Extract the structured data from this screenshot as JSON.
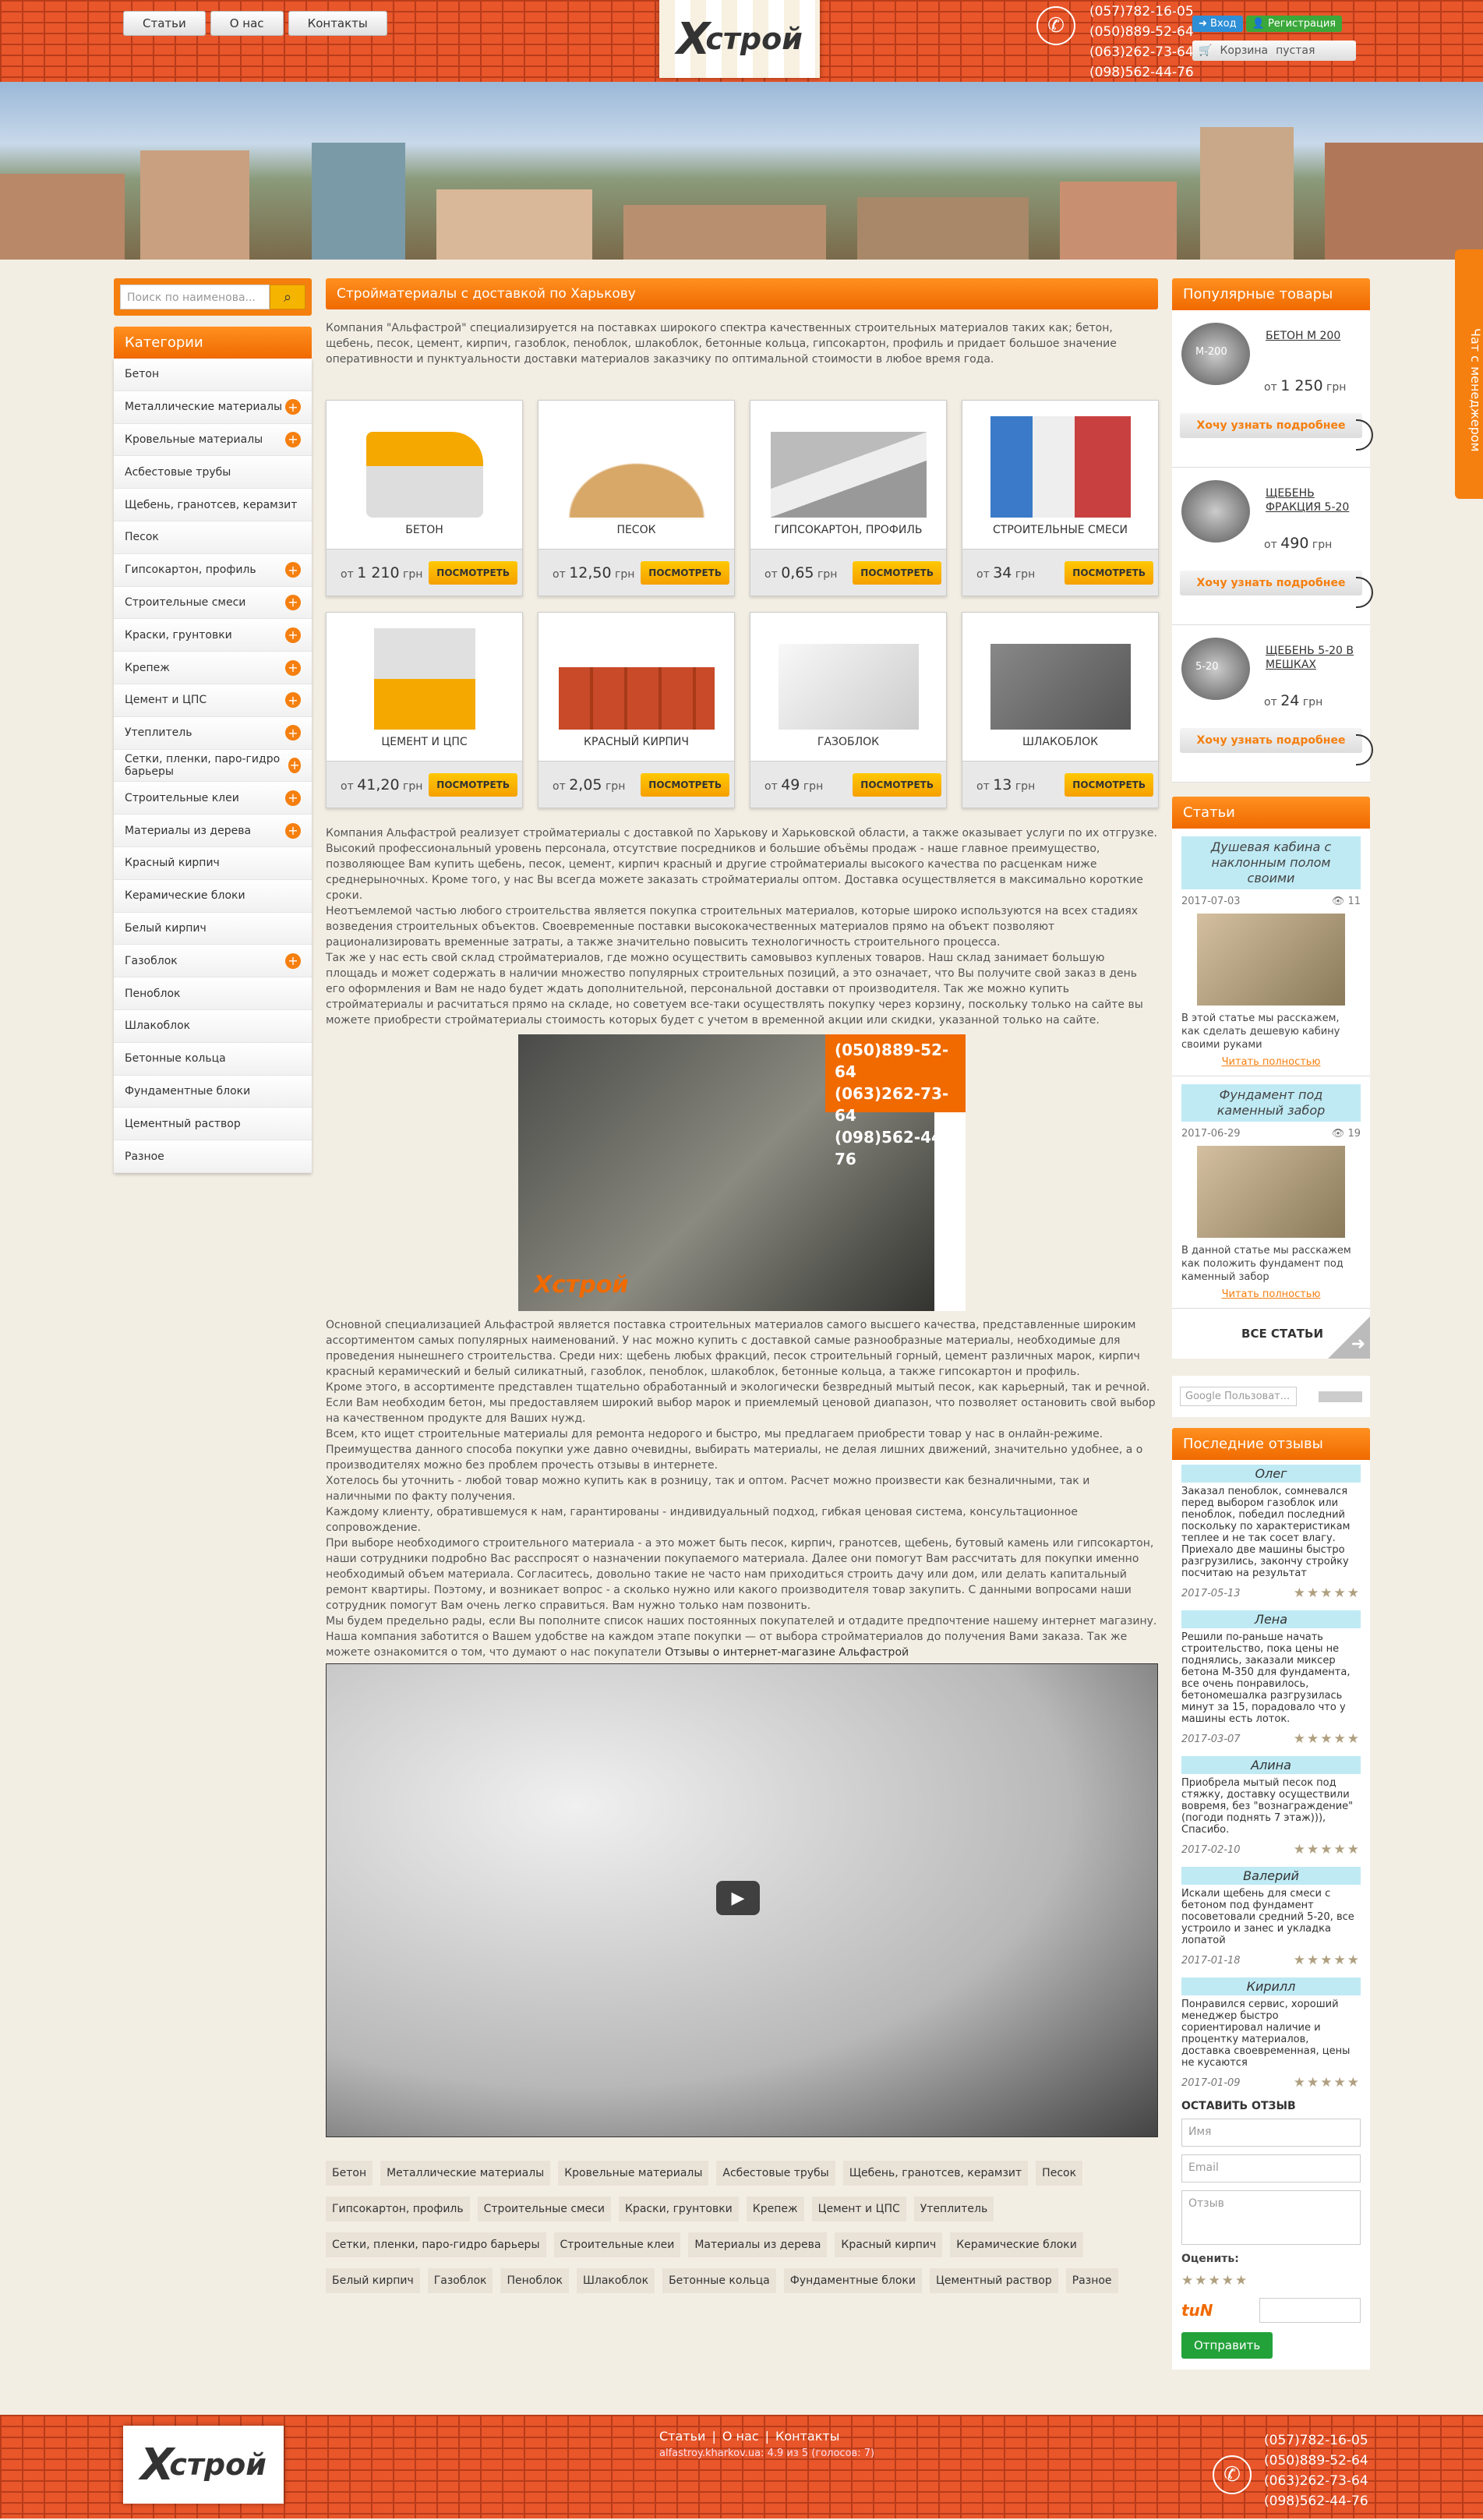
{
  "header": {
    "nav": [
      "Статьи",
      "О нас",
      "Контакты"
    ],
    "logo_text": "строй",
    "phones": [
      "(057)782-16-05",
      "(050)889-52-64",
      "(063)262-73-64",
      "(098)562-44-76"
    ],
    "login": "Вход",
    "register": "Регистрация",
    "cart_label": "Корзина",
    "cart_status": "пустая"
  },
  "search": {
    "placeholder": "Поиск по наименова..."
  },
  "categories": {
    "title": "Категории",
    "items": [
      {
        "label": "Бетон",
        "plus": false
      },
      {
        "label": "Металлические материалы",
        "plus": true
      },
      {
        "label": "Кровельные материалы",
        "plus": true
      },
      {
        "label": "Асбестовые трубы",
        "plus": false
      },
      {
        "label": "Щебень, гранотсев, керамзит",
        "plus": false
      },
      {
        "label": "Песок",
        "plus": false
      },
      {
        "label": "Гипсокартон, профиль",
        "plus": true
      },
      {
        "label": "Строительные смеси",
        "plus": true
      },
      {
        "label": "Краски, грунтовки",
        "plus": true
      },
      {
        "label": "Крепеж",
        "plus": true
      },
      {
        "label": "Цемент и ЦПС",
        "plus": true
      },
      {
        "label": "Утеплитель",
        "plus": true
      },
      {
        "label": "Сетки, пленки, паро-гидро барьеры",
        "plus": true
      },
      {
        "label": "Строительные клеи",
        "plus": true
      },
      {
        "label": "Материалы из дерева",
        "plus": true
      },
      {
        "label": "Красный кирпич",
        "plus": false
      },
      {
        "label": "Керамические блоки",
        "plus": false
      },
      {
        "label": "Белый кирпич",
        "plus": false
      },
      {
        "label": "Газоблок",
        "plus": true
      },
      {
        "label": "Пеноблок",
        "plus": false
      },
      {
        "label": "Шлакоблок",
        "plus": false
      },
      {
        "label": "Бетонные кольца",
        "plus": false
      },
      {
        "label": "Фундаментные блоки",
        "plus": false
      },
      {
        "label": "Цементный раствор",
        "plus": false
      },
      {
        "label": "Разное",
        "plus": false
      }
    ]
  },
  "main": {
    "title": "Стройматериалы с доставкой по Харькову",
    "intro": "Компания \"Альфастрой\" специализируется на поставках широкого спектра качественных строительных материалов таких как; бетон, щебень, песок, цемент, кирпич, газоблок, пеноблок, шлакоблок, бетонные кольца, гипсокартон, профиль и придает большое значение оперативности и пунктуальности доставки материалов заказчику по оптимальной стоимости в любое время года.",
    "price_prefix": "от",
    "currency": "грн",
    "look_label": "ПОСМОТРЕТЬ",
    "products": [
      {
        "name": "БЕТОН",
        "price": "1 210"
      },
      {
        "name": "ПЕСОК",
        "price": "12,50"
      },
      {
        "name": "ГИПСОКАРТОН, ПРОФИЛЬ",
        "price": "0,65"
      },
      {
        "name": "СТРОИТЕЛЬНЫЕ СМЕСИ",
        "price": "34"
      },
      {
        "name": "ЦЕМЕНТ И ЦПС",
        "price": "41,20"
      },
      {
        "name": "КРАСНЫЙ КИРПИЧ",
        "price": "2,05"
      },
      {
        "name": "ГАЗОБЛОК",
        "price": "49"
      },
      {
        "name": "ШЛАКОБЛОК",
        "price": "13"
      }
    ],
    "body1": "Компания Альфастрой реализует стройматериалы с доставкой по Харькову и Харьковской области, а также оказывает услуги по их отгрузке. Высокий профессиональный уровень персонала, отсутствие посредников и большие объёмы продаж - наше главное преимущество, позволяющее Вам купить щебень, песок, цемент, кирпич красный и другие стройматериалы высокого качества по расценкам ниже среднерыночных. Кроме того, у нас Вы всегда можете заказать стройматериалы оптом. Доставка осуществляется в максимально короткие сроки.",
    "body2": "Неотъемлемой частью любого строительства является покупка строительных материалов, которые широко используются на всех стадиях возведения строительных объектов. Своевременные поставки высококачественных материалов прямо на объект позволяют рационализировать временные затраты, а также значительно повысить технологичность строительного процесса.",
    "body3": "Так же у нас есть свой склад стройматериалов, где можно осуществить самовывоз купленых товаров. Наш склад занимает большую площадь и может содержать в наличии множество популярных строительных позиций, а это означает, что Вы получите свой заказ в день его оформления и Вам не надо будет ждать дополнительной, персональной доставки от производителя. Так же можно купить стройматериалы и расчитаться прямо на складе, но советуем все-таки осуществлять покупку через корзину, поскольку только на сайте вы можете приобрести стройматериалы стоимость которых будет с учетом в временной акции или скидки, указанной только на сайте.",
    "warehouse_phones": [
      "(050)889-52-64",
      "(063)262-73-64",
      "(098)562-44-76"
    ],
    "body4": "Основной специализацией Альфастрой является поставка строительных материалов самого высшего качества, представленные широким ассортиментом самых популярных наименований. У нас можно купить с доставкой самые разнообразные материалы, необходимые для проведения нынешнего строительства. Среди них: щебень любых фракций, песок строительный горный, цемент различных марок, кирпич красный керамический и белый силикатный, газоблок, пеноблок, шлакоблок, бетонные кольца, а также гипсокартон и профиль.",
    "body5": "Кроме этого, в ассортименте представлен тщательно обработанный и экологически безвредный мытый песок, как карьерный, так и речной. Если Вам необходим бетон, мы предоставляем широкий выбор марок и приемлемый ценовой диапазон, что позволяет остановить свой выбор на качественном продукте для Ваших нужд.",
    "body6": "Всем, кто ищет строительные материалы для ремонта недорого и быстро, мы предлагаем приобрести товар у нас в онлайн-режиме. Преимущества данного способа покупки уже давно очевидны, выбирать материалы, не делая лишних движений, значительно удобнее, а о производителях можно без проблем прочесть отзывы в интернете.",
    "body7": "Хотелось бы уточнить - любой товар можно купить как в розницу, так и оптом. Расчет можно произвести как безналичными, так и наличными по факту получения.",
    "body8": "Каждому клиенту, обратившемуся к нам, гарантированы - индивидуальный подход, гибкая ценовая система, консультационное сопровождение.",
    "body9": "При выборе необходимого строительного материала - а это может быть песок, кирпич, гранотсев, щебень, бутовый камень или гипсокартон, наши сотрудники подробно Вас расспросят о назначении покупаемого материала. Далее они помогут Вам рассчитать для покупки именно необходимый объем материала. Согласитесь, довольно такие не часто нам приходиться строить дачу или дом, или делать капитальный ремонт квартиры. Поэтому, и возникает вопрос - а сколько нужно или какого производителя товар закупить. С данными вопросами наши сотрудник помогут Вам очень легко справиться. Вам нужно только нам позвонить.",
    "body10": "Мы будем предельно рады, если Вы пополните список наших постоянных покупателей и отдадите предпочтение нашему интернет магазину. Наша компания заботится о Вашем удобстве на каждом этапе покупки — от выбора стройматериалов до получения Вами заказа. Так же можете ознакомится о том, что думают о нас покупатели",
    "reviews_link": "Отзывы о интернет-магазине Альфастрой",
    "tags": [
      "Бетон",
      "Металлические материалы",
      "Кровельные материалы",
      "Асбестовые трубы",
      "Щебень, гранотсев, керамзит",
      "Песок",
      "Гипсокартон, профиль",
      "Строительные смеси",
      "Краски, грунтовки",
      "Крепеж",
      "Цемент и ЦПС",
      "Утеплитель",
      "Сетки, пленки, паро-гидро барьеры",
      "Строительные клеи",
      "Материалы из дерева",
      "Красный кирпич",
      "Керамические блоки",
      "Белый кирпич",
      "Газоблок",
      "Пеноблок",
      "Шлакоблок",
      "Бетонные кольца",
      "Фундаментные блоки",
      "Цементный раствор",
      "Разное"
    ]
  },
  "popular": {
    "title": "Популярные товары",
    "want_label": "Хочу узнать подробнее",
    "items": [
      {
        "name": "БЕТОН М 200",
        "price": "1 250",
        "img_label": "М-200"
      },
      {
        "name": "ЩЕБЕНЬ ФРАКЦИЯ 5-20",
        "price": "490",
        "img_label": ""
      },
      {
        "name": "ЩЕБЕНЬ 5-20 В МЕШКАХ",
        "price": "24",
        "img_label": "5-20"
      }
    ]
  },
  "articles": {
    "title": "Статьи",
    "read_more": "Читать полностью",
    "all_label": "ВСЕ СТАТЬИ",
    "items": [
      {
        "title": "Душевая кабина с наклонным полом своими",
        "date": "2017-07-03",
        "views": "11",
        "text": "В этой статье мы расскажем, как сделать дешевую кабину своими руками"
      },
      {
        "title": "Фундамент под каменный забор",
        "date": "2017-06-29",
        "views": "19",
        "text": "В данной статье мы расскажем как положить фундамент под каменный забор"
      }
    ]
  },
  "google_search": {
    "placeholder": "Google Пользоват..."
  },
  "reviews": {
    "title": "Последние отзывы",
    "stars": "★★★★★",
    "items": [
      {
        "name": "Олег",
        "text": "Заказал пеноблок, сомневался перед выбором газоблок или пеноблок, победил последний поскольку по характеристикам теплее и не так сосет влагу. Приехало две машины быстро разгрузились, закончу стройку посчитаю на результат",
        "date": "2017-05-13"
      },
      {
        "name": "Лена",
        "text": "Решили по-раньше начать строительство, пока цены не поднялись, заказали миксер бетона М-350 для фундамента, все очень понравилось, бетономешалка разгрузилась минут за 15, порадовало что у машины есть лоток.",
        "date": "2017-03-07"
      },
      {
        "name": "Алина",
        "text": "Приобрела мытый песок под стяжку, доставку осуществили вовремя, без \"вознаграждение\" (погоди поднять 7 этаж))), Спасибо.",
        "date": "2017-02-10"
      },
      {
        "name": "Валерий",
        "text": "Искали щебень для смеси с бетоном под фундамент посоветовали средний 5-20, все устроило и занес и укладка лопатой",
        "date": "2017-01-18"
      },
      {
        "name": "Кирилл",
        "text": "Понравился сервис, хороший менеджер быстро сориентировал наличие и процентку материалов, доставка своевременная, цены не кусаются",
        "date": "2017-01-09"
      }
    ],
    "form_title": "ОСТАВИТЬ ОТЗЫВ",
    "name_ph": "Имя",
    "email_ph": "Email",
    "text_ph": "Отзыв",
    "rate_label": "Оценить:",
    "captcha": "tuN",
    "send": "Отправить"
  },
  "chat": "Чат с менеджером",
  "footer": {
    "links": [
      "Статьи",
      "О нас",
      "Контакты"
    ],
    "copy": "alfastroy.kharkov.ua: 4.9 из 5 (голосов: 7)",
    "phones": [
      "(057)782-16-05",
      "(050)889-52-64",
      "(063)262-73-64",
      "(098)562-44-76"
    ]
  }
}
